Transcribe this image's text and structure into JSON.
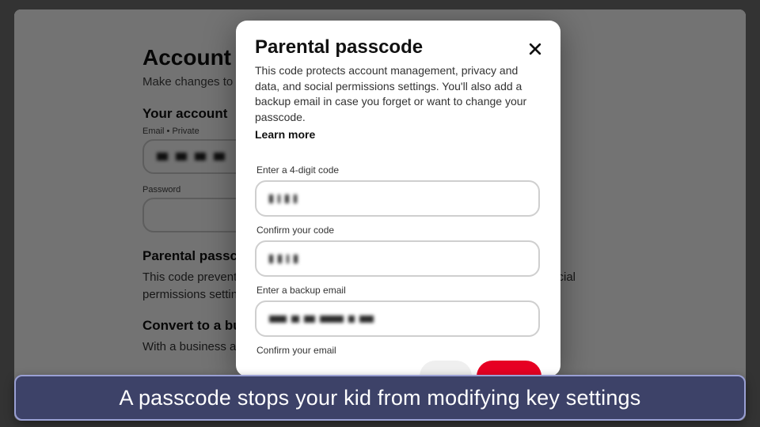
{
  "background": {
    "title": "Account management",
    "subtitle": "Make changes to your personal information or account type.",
    "section_account": "Your account",
    "email_label": "Email • Private",
    "password_label": "Password",
    "passcode_heading": "Parental passcode",
    "passcode_body": "This code prevents changes to account management, privacy and data, and social permissions settings.",
    "convert_heading": "Convert to a business account",
    "convert_body": "With a business account, you get access to tools like ads and analytics."
  },
  "modal": {
    "title": "Parental passcode",
    "description": "This code protects account management, privacy and data, and social permissions settings. You'll also add a backup email in case you forget or want to change your passcode.",
    "learn_more": "Learn more",
    "fields": {
      "code_label": "Enter a 4-digit code",
      "confirm_code_label": "Confirm your code",
      "backup_email_label": "Enter a backup email",
      "confirm_email_label": "Confirm your email"
    }
  },
  "caption": "A passcode stops your kid from modifying key settings"
}
